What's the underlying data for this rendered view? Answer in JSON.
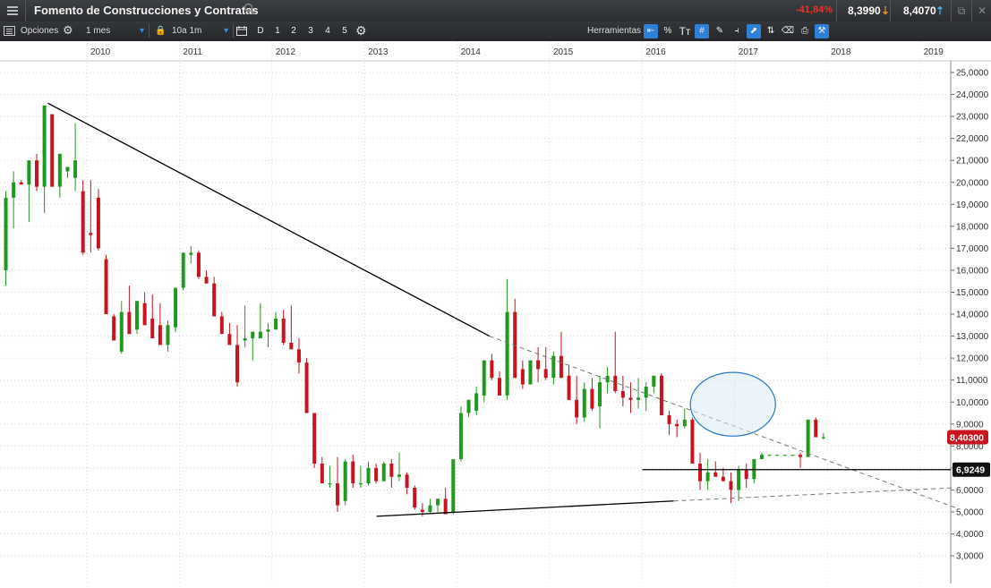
{
  "header": {
    "menu_icon": "hamburger-menu-icon",
    "instrument_name": "Fomento de Construcciones y Contratas",
    "change_pct": "-41,84%",
    "bid": "8,3990",
    "ask": "8,4070",
    "change_color": "#e8342c"
  },
  "toolbar": {
    "options_label": "Opciones",
    "interval_value": "1 mes",
    "range_value": "10a 1m",
    "period_buttons": [
      "D",
      "1",
      "2",
      "3",
      "4",
      "5"
    ],
    "tools_label": "Herramientas",
    "percent_label": "%",
    "text_tool_label": "Tᴛ"
  },
  "chart_data": {
    "type": "candlestick",
    "interval": "monthly",
    "x_axis_labels": [
      "2010",
      "2011",
      "2012",
      "2013",
      "2014",
      "2015",
      "2016",
      "2017",
      "2018",
      "2019"
    ],
    "y_axis": {
      "min": 3,
      "max": 25,
      "step": 1,
      "tick_format": "comma-4-decimals"
    },
    "up_color": "#1f9a1f",
    "down_color": "#c8141e",
    "last_price_label": "8,40300",
    "level_label": "6,9249",
    "level_value": 6.9249,
    "candles": [
      [
        13.5,
        18.5,
        12.2,
        16.0
      ],
      [
        16.0,
        19.6,
        15.3,
        19.3
      ],
      [
        19.3,
        20.5,
        17.9,
        20.0
      ],
      [
        20.0,
        20.1,
        19.9,
        19.9
      ],
      [
        19.9,
        21.0,
        18.2,
        21.0
      ],
      [
        21.0,
        21.3,
        19.6,
        19.8
      ],
      [
        19.8,
        23.5,
        18.6,
        23.5
      ],
      [
        23.1,
        23.1,
        19.8,
        19.8
      ],
      [
        19.8,
        21.3,
        19.3,
        21.3
      ],
      [
        20.5,
        20.7,
        20.2,
        20.7
      ],
      [
        20.2,
        22.7,
        19.6,
        21.0
      ],
      [
        19.6,
        20.1,
        16.7,
        16.8
      ],
      [
        17.7,
        20.1,
        16.8,
        17.6
      ],
      [
        19.3,
        19.7,
        16.9,
        17.0
      ],
      [
        16.5,
        16.7,
        14.0,
        14.0
      ],
      [
        13.9,
        14.0,
        12.8,
        12.8
      ],
      [
        12.3,
        14.6,
        12.2,
        14.1
      ],
      [
        14.1,
        15.3,
        13.1,
        13.1
      ],
      [
        13.3,
        14.6,
        13.1,
        14.6
      ],
      [
        14.5,
        15.0,
        13.5,
        13.5
      ],
      [
        13.8,
        14.9,
        12.9,
        12.9
      ],
      [
        13.5,
        14.5,
        12.6,
        12.6
      ],
      [
        12.6,
        13.7,
        12.3,
        13.5
      ],
      [
        13.4,
        15.2,
        13.2,
        15.2
      ],
      [
        15.2,
        16.4,
        15.1,
        16.8
      ],
      [
        16.7,
        17.1,
        16.3,
        16.8
      ],
      [
        16.8,
        16.9,
        15.6,
        15.7
      ],
      [
        15.7,
        16.0,
        15.4,
        15.4
      ],
      [
        15.4,
        15.7,
        13.9,
        13.9
      ],
      [
        13.9,
        14.1,
        13.1,
        13.1
      ],
      [
        13.1,
        13.6,
        12.6,
        12.6
      ],
      [
        12.6,
        13.5,
        10.7,
        10.9
      ],
      [
        12.8,
        14.4,
        12.5,
        12.9
      ],
      [
        12.9,
        13.2,
        11.9,
        13.2
      ],
      [
        12.9,
        14.5,
        12.9,
        13.2
      ],
      [
        13.2,
        13.6,
        12.5,
        13.3
      ],
      [
        13.3,
        14.1,
        13.3,
        13.8
      ],
      [
        13.8,
        14.2,
        12.6,
        12.7
      ],
      [
        12.7,
        14.4,
        12.4,
        12.4
      ],
      [
        12.4,
        12.9,
        11.3,
        11.8
      ],
      [
        11.8,
        12.0,
        9.5,
        9.5
      ],
      [
        9.5,
        9.5,
        7.0,
        7.2
      ],
      [
        7.2,
        7.5,
        6.3,
        6.3
      ],
      [
        6.3,
        7.1,
        6.1,
        6.3
      ],
      [
        6.3,
        7.5,
        5.0,
        5.3
      ],
      [
        5.5,
        7.4,
        5.3,
        7.3
      ],
      [
        7.3,
        7.6,
        6.1,
        6.3
      ],
      [
        6.3,
        7.1,
        6.1,
        6.3
      ],
      [
        6.3,
        7.3,
        6.2,
        7.0
      ],
      [
        7.0,
        7.2,
        6.3,
        6.4
      ],
      [
        6.4,
        7.3,
        6.4,
        7.2
      ],
      [
        7.2,
        7.4,
        6.1,
        6.6
      ],
      [
        6.6,
        7.7,
        6.4,
        6.7
      ],
      [
        6.7,
        6.8,
        5.8,
        6.1
      ],
      [
        6.1,
        6.2,
        5.1,
        5.2
      ],
      [
        5.1,
        5.4,
        4.8,
        5.0
      ],
      [
        5.0,
        5.6,
        4.9,
        5.3
      ],
      [
        5.3,
        5.6,
        5.0,
        5.6
      ],
      [
        5.6,
        6.1,
        4.9,
        4.9
      ],
      [
        5.0,
        7.3,
        4.9,
        7.4
      ],
      [
        7.4,
        9.8,
        7.3,
        9.5
      ],
      [
        9.5,
        10.1,
        9.3,
        10.1
      ],
      [
        9.6,
        10.7,
        9.4,
        10.4
      ],
      [
        10.3,
        11.9,
        10.0,
        11.9
      ],
      [
        11.9,
        12.2,
        11.0,
        11.1
      ],
      [
        11.1,
        11.4,
        10.3,
        10.3
      ],
      [
        10.3,
        15.6,
        10.1,
        14.1
      ],
      [
        14.1,
        14.7,
        11.2,
        11.1
      ],
      [
        11.5,
        11.9,
        10.6,
        10.8
      ],
      [
        10.8,
        11.9,
        10.8,
        11.9
      ],
      [
        11.9,
        12.5,
        10.9,
        11.5
      ],
      [
        11.5,
        12.5,
        11.0,
        11.1
      ],
      [
        11.1,
        12.3,
        10.8,
        12.1
      ],
      [
        12.1,
        13.2,
        11.2,
        11.1
      ],
      [
        11.2,
        11.7,
        10.1,
        10.1
      ],
      [
        10.1,
        11.2,
        9.0,
        9.3
      ],
      [
        9.3,
        10.9,
        9.1,
        10.6
      ],
      [
        10.6,
        11.1,
        9.6,
        9.7
      ],
      [
        9.8,
        11.2,
        8.8,
        10.9
      ],
      [
        10.9,
        11.6,
        10.4,
        11.2
      ],
      [
        11.2,
        13.2,
        10.4,
        10.5
      ],
      [
        10.5,
        11.2,
        9.8,
        10.2
      ],
      [
        10.2,
        10.9,
        9.5,
        10.1
      ],
      [
        10.1,
        11.1,
        9.7,
        10.2
      ],
      [
        10.2,
        10.9,
        9.6,
        10.7
      ],
      [
        10.7,
        11.2,
        10.4,
        11.2
      ],
      [
        11.2,
        11.3,
        9.6,
        9.4
      ],
      [
        9.4,
        9.6,
        8.5,
        9.0
      ],
      [
        9.0,
        9.2,
        8.4,
        8.9
      ],
      [
        8.9,
        9.7,
        8.8,
        9.2
      ],
      [
        9.2,
        9.3,
        7.2,
        7.2
      ],
      [
        7.2,
        7.7,
        6.0,
        6.4
      ],
      [
        6.4,
        7.4,
        6.0,
        6.8
      ],
      [
        6.8,
        7.3,
        6.6,
        6.6
      ],
      [
        6.6,
        7.0,
        6.4,
        6.4
      ],
      [
        6.4,
        6.8,
        5.4,
        6.0
      ],
      [
        6.0,
        7.1,
        5.5,
        6.9
      ],
      [
        6.9,
        7.2,
        6.1,
        6.5
      ],
      [
        6.5,
        7.4,
        6.3,
        7.4
      ],
      [
        7.4,
        7.7,
        7.4,
        7.6
      ],
      [
        7.6,
        7.6,
        7.6,
        7.6
      ],
      [
        7.6,
        7.6,
        7.6,
        7.6
      ],
      [
        7.6,
        7.6,
        7.6,
        7.6
      ],
      [
        7.6,
        7.6,
        7.6,
        7.6
      ],
      [
        7.6,
        7.7,
        7.0,
        7.5
      ],
      [
        7.5,
        9.2,
        7.5,
        9.2
      ],
      [
        9.2,
        9.3,
        8.4,
        8.4
      ],
      [
        8.4,
        8.6,
        8.3,
        8.4
      ]
    ],
    "trendlines": [
      {
        "style": "solid",
        "from": [
          2009.58,
          23.6
        ],
        "to": [
          2014.35,
          13.0
        ]
      },
      {
        "style": "dashed",
        "from": [
          2014.35,
          13.0
        ],
        "to": [
          2019.38,
          5.2
        ]
      },
      {
        "style": "solid",
        "from": [
          2013.13,
          4.8
        ],
        "to": [
          2016.34,
          5.5
        ]
      },
      {
        "style": "dashed",
        "from": [
          2016.34,
          5.5
        ],
        "to": [
          2019.38,
          6.1
        ]
      }
    ],
    "ellipse_annotation": {
      "center": [
        2016.98,
        9.9
      ],
      "radius_years": 0.46,
      "radius_value": 1.45,
      "stroke": "#2a78c8",
      "fill": "#dbe9f8"
    }
  }
}
